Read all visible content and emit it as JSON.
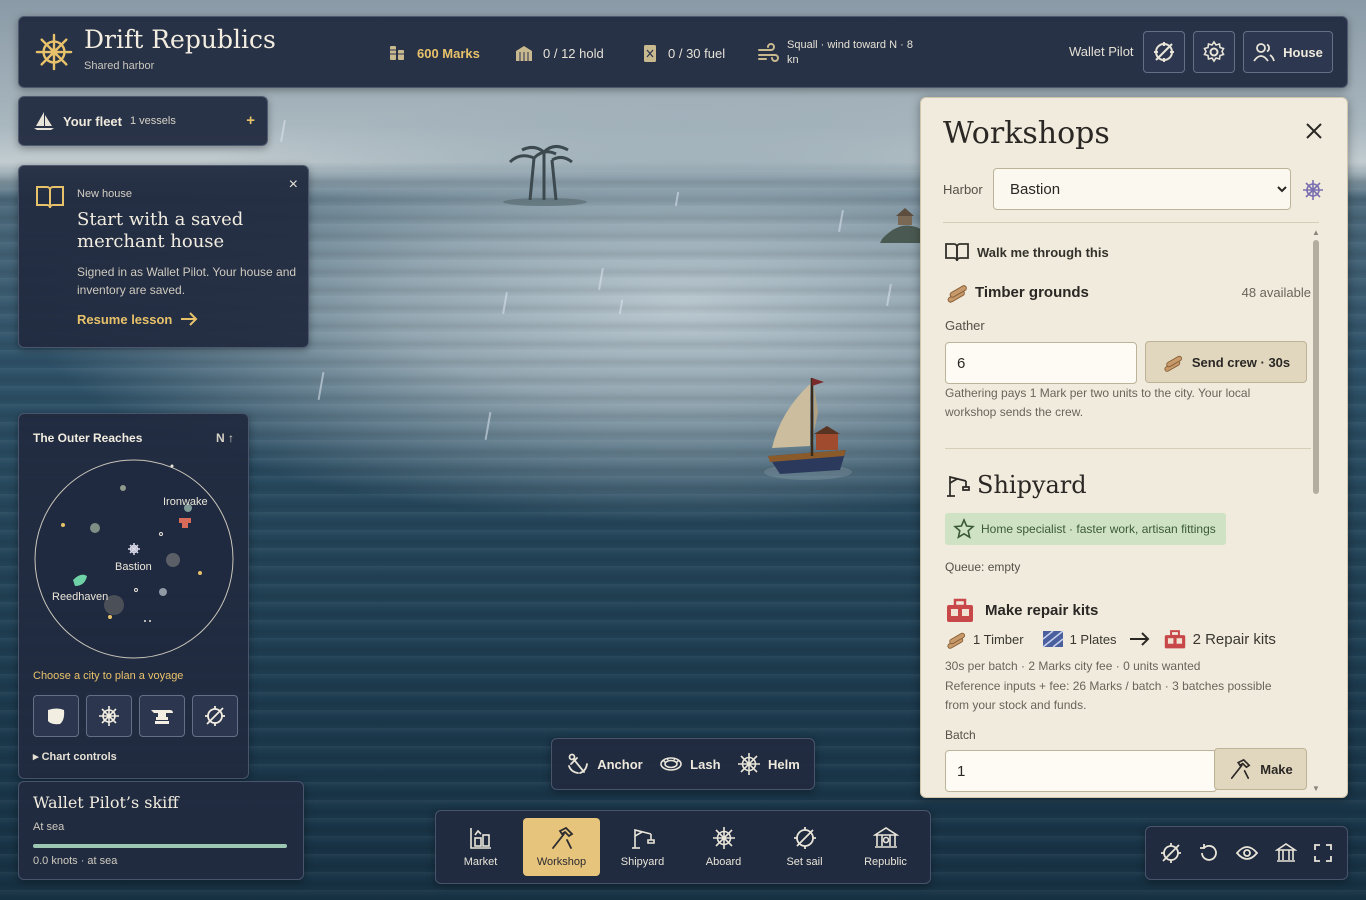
{
  "topbar": {
    "title": "Drift Republics",
    "subtitle": "Shared harbor",
    "marks": "600 Marks",
    "hold": "0 / 12 hold",
    "fuel": "0 / 30 fuel",
    "wind": "Squall · wind toward N · 8 kn",
    "pilot": "Wallet Pilot",
    "house_button": "House"
  },
  "fleet": {
    "title": "Your fleet",
    "count": "1 vessels",
    "add": "+"
  },
  "lesson": {
    "kicker": "New house",
    "title": "Start with a saved merchant house",
    "body": "Signed in as Wallet Pilot. Your house and inventory are saved.",
    "link": "Resume lesson",
    "close": "×"
  },
  "map": {
    "title": "The Outer Reaches",
    "north": "N ↑",
    "cities": [
      "Ironwake",
      "Bastion",
      "Reedhaven"
    ],
    "hint": "Choose a city to plan a voyage",
    "chart_controls": "▸ Chart controls",
    "tools": [
      "leaf-icon",
      "helm-icon",
      "anvil-icon",
      "compass-icon"
    ]
  },
  "skiff": {
    "title": "Wallet Pilot’s skiff",
    "status": "At sea",
    "speed": "0.0 knots · at sea",
    "progress": 1.0
  },
  "actions": [
    {
      "label": "Anchor",
      "icon": "anchor-icon"
    },
    {
      "label": "Lash",
      "icon": "rope-icon"
    },
    {
      "label": "Helm",
      "icon": "helm-icon"
    }
  ],
  "nav": [
    {
      "label": "Market",
      "icon": "market-icon",
      "active": false
    },
    {
      "label": "Workshop",
      "icon": "hammer-icon",
      "active": true
    },
    {
      "label": "Shipyard",
      "icon": "crane-icon",
      "active": false
    },
    {
      "label": "Aboard",
      "icon": "helm-icon",
      "active": false
    },
    {
      "label": "Set sail",
      "icon": "compass-icon",
      "active": false
    },
    {
      "label": "Republic",
      "icon": "republic-icon",
      "active": false
    }
  ],
  "workshop": {
    "title": "Workshops",
    "harbor_label": "Harbor",
    "harbor_value": "Bastion",
    "walkthrough": "Walk me through this",
    "timber": {
      "name": "Timber grounds",
      "available": "48 available",
      "gather_label": "Gather",
      "gather_value": "6",
      "send_button": "Send crew · 30s",
      "note": "Gathering pays 1 Mark per two units to the city. Your local workshop sends the crew."
    },
    "shipyard": {
      "name": "Shipyard",
      "badge": "Home specialist · faster work, artisan fittings",
      "queue": "Queue: empty",
      "recipe_name": "Make repair kits",
      "input1": "1 Timber",
      "input2": "1 Plates",
      "output": "2 Repair kits",
      "meta": "30s per batch · 2 Marks city fee · 0 units wanted",
      "reference": "Reference inputs + fee: 26 Marks / batch · 3 batches possible from your stock and funds.",
      "batch_label": "Batch",
      "batch_value": "1",
      "make_button": "Make"
    }
  },
  "colors": {
    "panel": "#212a40",
    "gold": "#e8c26a",
    "parchment": "#f0ebdc",
    "active_nav": "#e7c47c"
  }
}
